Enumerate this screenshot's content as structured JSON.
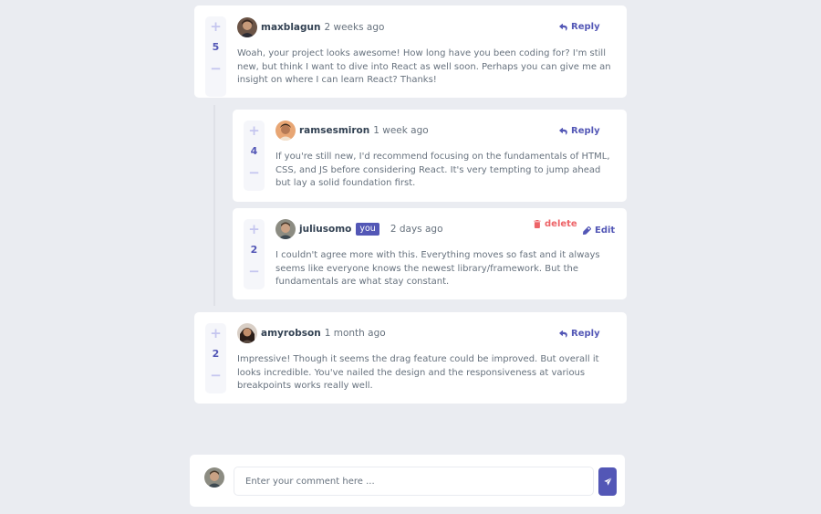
{
  "colors": {
    "background": "#eaecf1",
    "card": "#ffffff",
    "accent": "#5357b6",
    "accent_light": "#c5c6ef",
    "danger": "#ed6468",
    "heading": "#334253",
    "body_text": "#67727e"
  },
  "comments": [
    {
      "username": "maxblagun",
      "timestamp": "2 weeks ago",
      "score": "5",
      "content": "Woah, your project looks awesome! How long have you been coding for? I'm still new, but think I want to dive into React as well soon. Perhaps you can give me an insight on where I can learn React? Thanks!",
      "reply_label": "Reply"
    },
    {
      "username": "amyrobson",
      "timestamp": "1 month ago",
      "score": "2",
      "content": "Impressive! Though it seems the drag feature could be improved. But overall it looks incredible. You've nailed the design and the responsiveness at various breakpoints works really well.",
      "reply_label": "Reply"
    }
  ],
  "replies": [
    {
      "username": "ramsesmiron",
      "timestamp": "1 week ago",
      "score": "4",
      "content": "If you're still new, I'd recommend focusing on the fundamentals of HTML, CSS, and JS before considering React. It's very tempting to jump ahead but lay a solid foundation first.",
      "reply_label": "Reply"
    },
    {
      "username": "juliusomo",
      "you_badge": "you",
      "timestamp": "2 days ago",
      "score": "2",
      "content": "I couldn't agree more with this. Everything moves so fast and it always seems like everyone knows the newest library/framework. But the fundamentals are what stay constant.",
      "delete_label": "delete",
      "edit_label": "Edit"
    }
  ],
  "vote": {
    "plus": "+",
    "minus": "−"
  },
  "composer": {
    "placeholder": "Enter your comment here ...",
    "value": "",
    "send_icon": "send-icon"
  }
}
